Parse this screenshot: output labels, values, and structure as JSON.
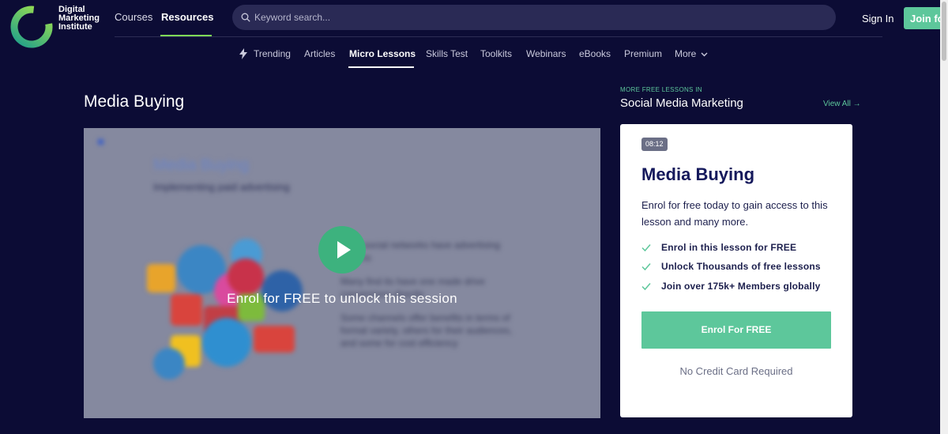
{
  "header": {
    "logo_lines": [
      "Digital",
      "Marketing",
      "Institute"
    ],
    "nav": [
      {
        "label": "Courses"
      },
      {
        "label": "Resources"
      }
    ],
    "search_placeholder": "Keyword search...",
    "sign_in": "Sign In",
    "join": "Join for"
  },
  "subnav": {
    "items": [
      "Trending",
      "Articles",
      "Micro Lessons",
      "Skills Test",
      "Toolkits",
      "Webinars",
      "eBooks",
      "Premium",
      "More"
    ],
    "active": "Micro Lessons"
  },
  "main": {
    "title": "Media Buying",
    "video": {
      "overlay_text": "Enrol for FREE to unlock this session",
      "slide_title": "Media Buying",
      "slide_subtitle": "Implementing paid advertising"
    }
  },
  "sidebar": {
    "label": "MORE FREE LESSONS IN",
    "category": "Social Media Marketing",
    "view_all": "View All →",
    "card": {
      "duration": "08:12",
      "title": "Media Buying",
      "description": "Enrol for free today to gain access to this lesson and many more.",
      "benefits": [
        "Enrol in this lesson for FREE",
        "Unlock Thousands of free lessons",
        "Join over 175k+ Members globally"
      ],
      "cta": "Enrol For FREE",
      "note": "No Credit Card Required"
    }
  },
  "colors": {
    "background": "#0c0c35",
    "accent": "#5dc79b",
    "nav_highlight": "#7ed957",
    "card_title": "#15195c"
  },
  "icons": [
    "dmi-logo-icon",
    "search-icon",
    "bolt-icon",
    "chevron-down-icon",
    "play-icon",
    "check-icon"
  ]
}
